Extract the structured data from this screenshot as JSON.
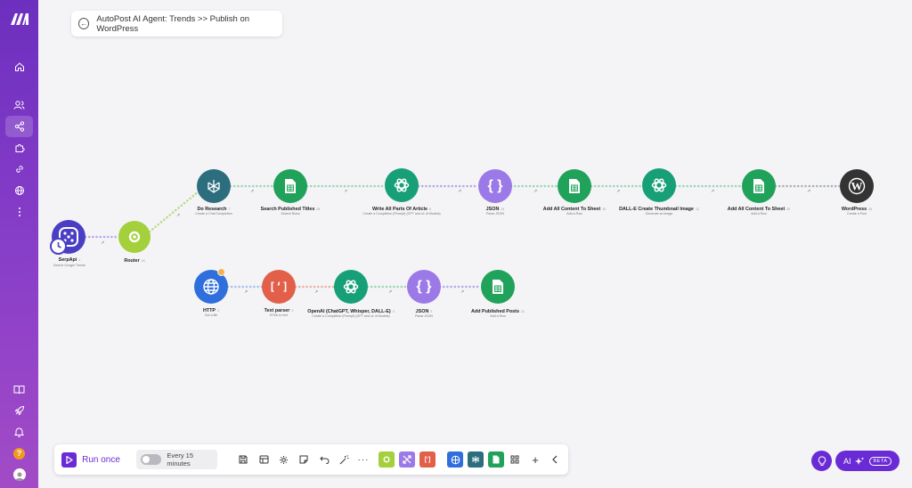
{
  "scenario": {
    "title": "AutoPost AI Agent: Trends >> Publish on WordPress"
  },
  "sidebar": {
    "items": [
      {
        "icon": "home-icon"
      },
      {
        "icon": "users-icon"
      },
      {
        "icon": "share-icon"
      },
      {
        "icon": "puzzle-icon"
      },
      {
        "icon": "link-icon"
      },
      {
        "icon": "globe-icon"
      },
      {
        "icon": "more-vertical-icon"
      }
    ],
    "bottom": [
      {
        "icon": "book-icon"
      },
      {
        "icon": "rocket-icon"
      },
      {
        "icon": "bell-icon"
      },
      {
        "icon": "help-icon",
        "label": "?"
      },
      {
        "icon": "user-avatar-icon"
      }
    ]
  },
  "nodes": {
    "serpapi": {
      "label": "SerpApi",
      "num": "1",
      "sub": "Search Google Trends",
      "color": "#4a3ec4"
    },
    "router": {
      "label": "Router",
      "num": "15",
      "color": "#a3d03b"
    },
    "do_research": {
      "label": "Do Research",
      "num": "7",
      "sub": "Create a Chat Completion",
      "color": "#2c6e7e"
    },
    "search_titles": {
      "label": "Search Published Titles",
      "num": "28",
      "sub": "Search Rows",
      "color": "#21a25a"
    },
    "write_article": {
      "label": "Write All Parts Of Article",
      "num": "6",
      "sub": "Create a Completion (Prompt) (GPT and o1 of Models)",
      "color": "#17a077"
    },
    "json1": {
      "label": "JSON",
      "num": "24",
      "sub": "Parse JSON",
      "color": "#9b7ae8"
    },
    "add_content1": {
      "label": "Add All Content To Sheet",
      "num": "19",
      "sub": "Add a Row",
      "color": "#21a25a"
    },
    "dalle": {
      "label": "DALL-E Create Thumbnail Image",
      "num": "12",
      "sub": "Generate an image",
      "color": "#17a077"
    },
    "add_content2": {
      "label": "Add All Content To Sheet",
      "num": "20",
      "sub": "Add a Row",
      "color": "#21a25a"
    },
    "wordpress": {
      "label": "WordPress",
      "num": "26",
      "sub": "Create a Post",
      "color": "#333333"
    },
    "http": {
      "label": "HTTP",
      "num": "2",
      "sub": "Get a file",
      "color": "#2f6fdd"
    },
    "text_parser": {
      "label": "Text parser",
      "num": "3",
      "sub": "HTML to text",
      "color": "#e2604a"
    },
    "openai": {
      "label": "OpenAI (ChatGPT, Whisper, DALL-E)",
      "num": "4",
      "sub": "Create a Completion (Prompt) (GPT and o1 of Models)",
      "color": "#17a077"
    },
    "json2": {
      "label": "JSON",
      "num": "5",
      "sub": "Parse JSON",
      "color": "#9b7ae8"
    },
    "add_published": {
      "label": "Add Published Posts",
      "num": "21",
      "sub": "Add a Row",
      "color": "#21a25a"
    }
  },
  "toolbar": {
    "run_label": "Run once",
    "schedule_label": "Every 15 minutes",
    "colors": {
      "accent": "#6a2bd6",
      "tools": "#a3d03b",
      "flow": "#9b7ae8",
      "text": "#e2604a",
      "http": "#2f6fdd",
      "ai": "#2c6e7e",
      "sheets": "#21a25a"
    }
  },
  "ai_button": {
    "label": "AI",
    "badge": "BETA"
  }
}
